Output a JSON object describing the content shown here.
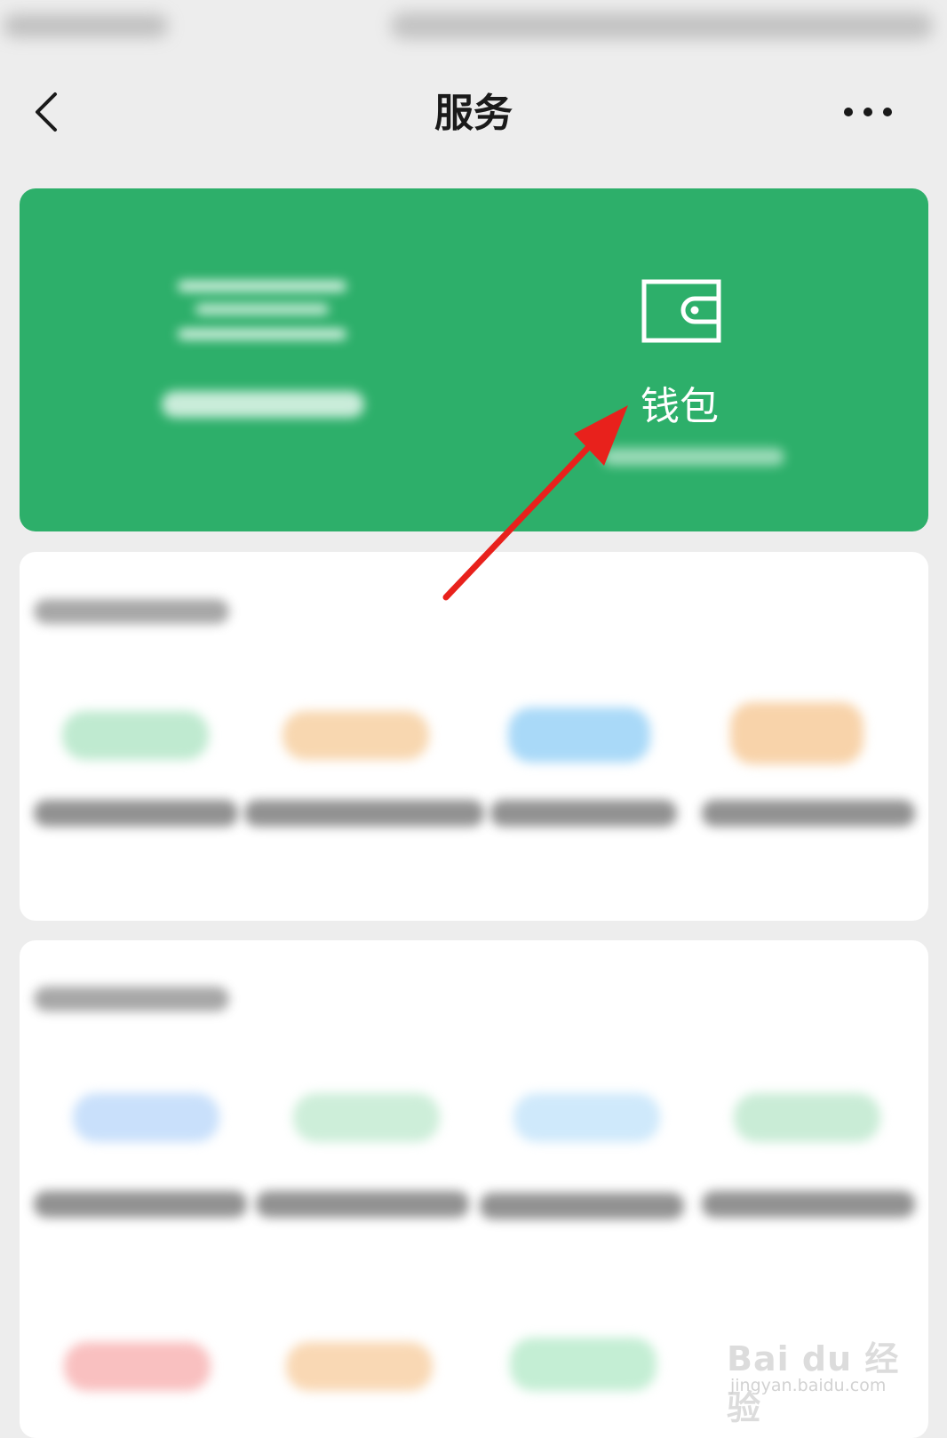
{
  "header": {
    "title": "服务",
    "back_icon": "chevron-left-icon",
    "more_icon": "more-dots-icon"
  },
  "wallet_card": {
    "background": "#2daf6a",
    "wallet_label": "钱包",
    "wallet_icon": "wallet-icon"
  },
  "annotation": {
    "arrow_color": "#e8211c"
  },
  "service_section_1": {
    "item_colors": [
      "#2fbf6f",
      "#f1a043",
      "#4fb0f1",
      "#f3a85a"
    ]
  },
  "service_section_2": {
    "row1_colors": [
      "#4f95ef",
      "#5fd38b",
      "#63b9f3",
      "#43c17a"
    ],
    "row2_colors": [
      "#f05a5a",
      "#f1a043",
      "#3fc27a"
    ]
  },
  "watermark": {
    "brand": "Bai du 经验",
    "url": "jingyan.baidu.com"
  }
}
